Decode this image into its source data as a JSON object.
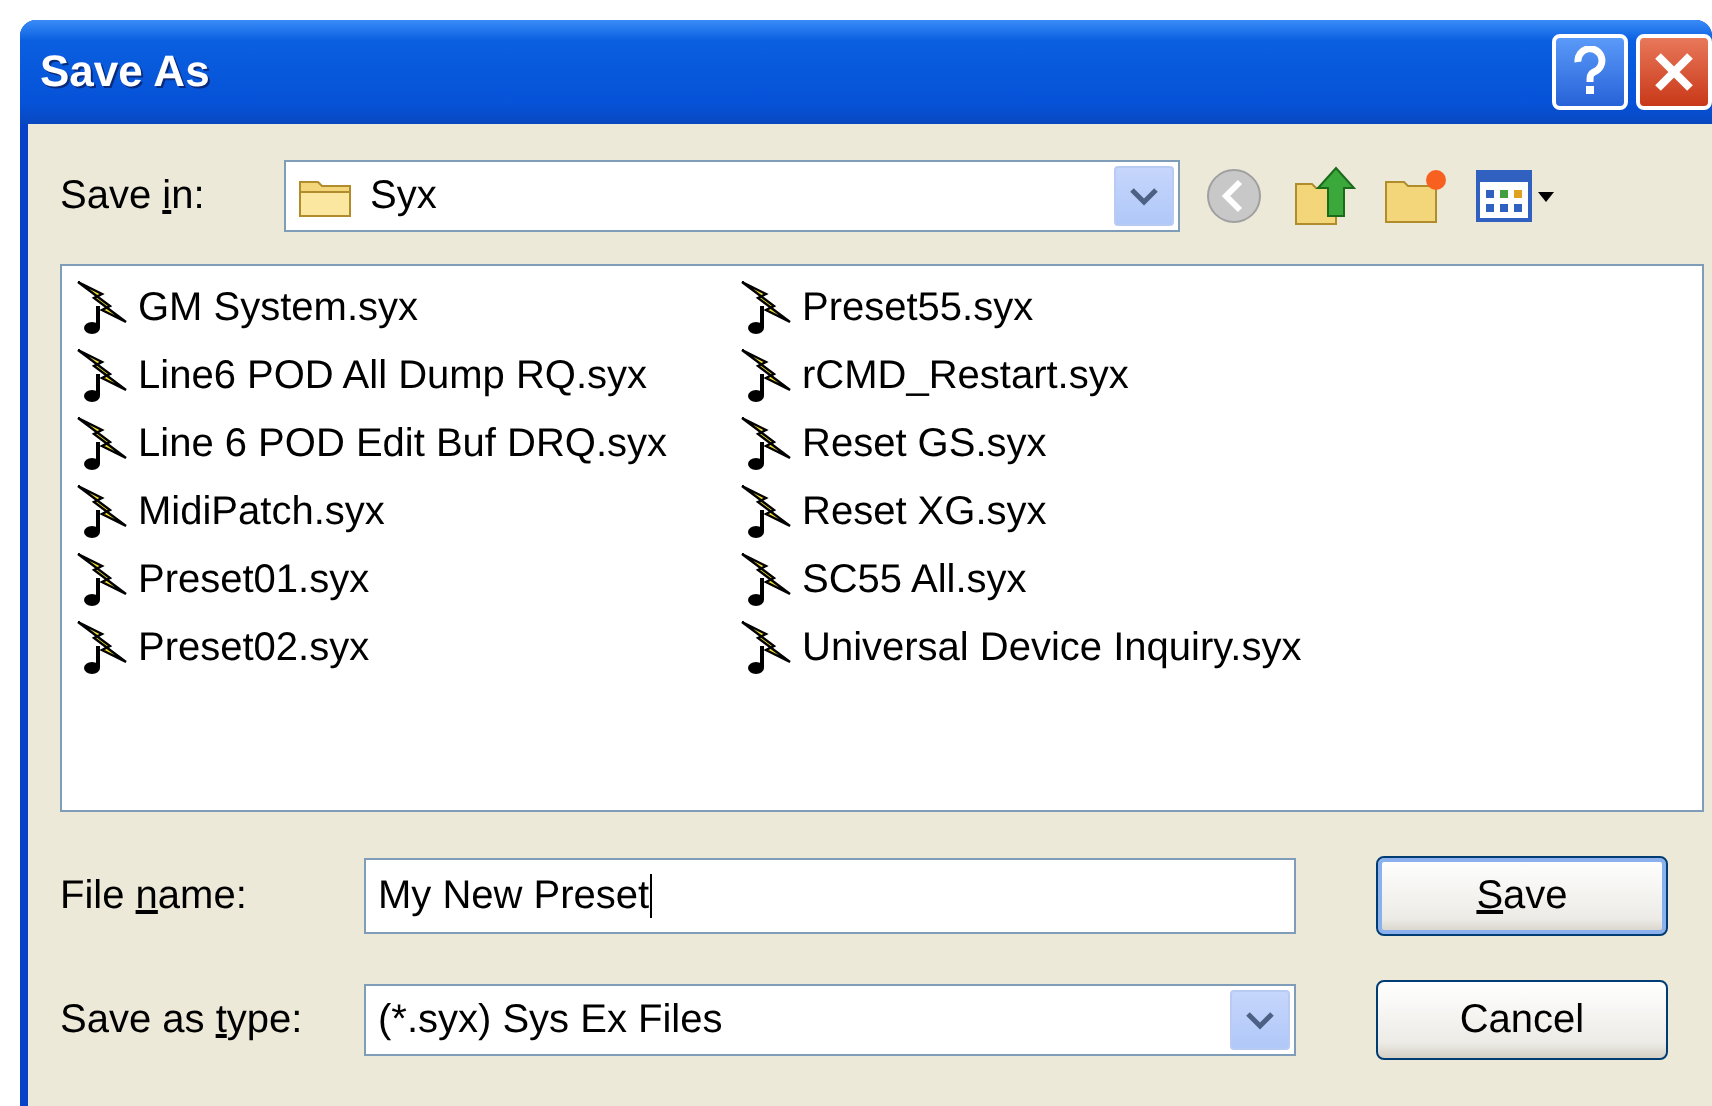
{
  "window": {
    "title": "Save As"
  },
  "save_in": {
    "label_parts": [
      "Save ",
      "i",
      "n:"
    ],
    "value": "Syx"
  },
  "files": [
    {
      "name": "GM System.syx",
      "selected": false
    },
    {
      "name": "Line6 POD All Dump RQ.syx",
      "selected": false
    },
    {
      "name": "Line 6 POD Edit Buf DRQ.syx",
      "selected": false
    },
    {
      "name": "MidiPatch.syx",
      "selected": false
    },
    {
      "name": "Preset01.syx",
      "selected": false
    },
    {
      "name": "Preset02.syx",
      "selected": false
    },
    {
      "name": "Preset55.syx",
      "selected": false
    },
    {
      "name": "rCMD_Restart.syx",
      "selected": false
    },
    {
      "name": "Reset GS.syx",
      "selected": false
    },
    {
      "name": "Reset XG.syx",
      "selected": false
    },
    {
      "name": "SC55 All.syx",
      "selected": false
    },
    {
      "name": "Universal Device Inquiry.syx",
      "selected": false
    }
  ],
  "file_name": {
    "label_parts": [
      "File ",
      "n",
      "ame:"
    ],
    "value": "My New Preset"
  },
  "save_as_type": {
    "label_parts": [
      "Save as ",
      "t",
      "ype:"
    ],
    "value": "(*.syx) Sys Ex Files"
  },
  "buttons": [
    {
      "label_parts": {
        "key": "S",
        "after": "ave"
      },
      "default": true
    },
    {
      "label_parts": {
        "before": "Cancel"
      },
      "default": false
    }
  ]
}
